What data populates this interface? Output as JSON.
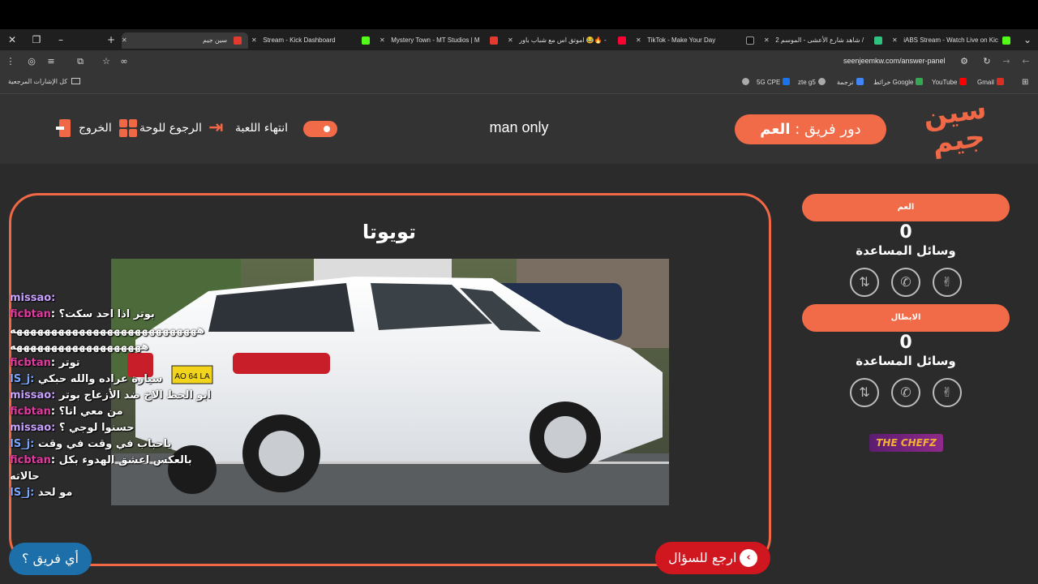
{
  "browser": {
    "tabs": [
      {
        "title": "سين جيم",
        "color": "#e23a2f"
      },
      {
        "title": "Stream - Kick Dashboard",
        "color": "#53fc18"
      },
      {
        "title": "Mystery Town - MT Studios | M",
        "color": "#e23a2f"
      },
      {
        "title": "اموتق اس مع شباب باور 😂🔥 -",
        "color": "#ff0033"
      },
      {
        "title": "TikTok - Make Your Day",
        "color": "#111111"
      },
      {
        "title": "شاهد شارع الأعشى - الموسم 2 /",
        "color": "#2ec27e"
      },
      {
        "title": "iABS Stream - Watch Live on Kic",
        "color": "#53fc18"
      }
    ],
    "url": "seenjeemkw.com/answer-panel",
    "bookmarks_folder": "كل الإشارات المرجعية",
    "bookmarks": [
      {
        "label": "Gmail",
        "color": "#d93025"
      },
      {
        "label": "YouTube",
        "color": "#ff0000"
      },
      {
        "label": "خرائط Google",
        "color": "#34a853"
      },
      {
        "label": "ترجمة",
        "color": "#4285f4"
      },
      {
        "label": "zte g5",
        "color": "#aaaaaa"
      },
      {
        "label": "5G CPE",
        "color": "#1a73e8"
      }
    ]
  },
  "header": {
    "logo_line1": "سين",
    "logo_line2": "جيم",
    "turn_prefix": "دور فريق :",
    "turn_team": "العم",
    "mode": "man only",
    "end_game": "انتهاء اللعبة",
    "back_to_board": "الرجوع للوحة",
    "exit": "الخروج"
  },
  "question": {
    "answer": "تويوتا",
    "plate_text": "AO 64 LA"
  },
  "teams": [
    {
      "name": "العم",
      "score": "0",
      "aids_title": "وسائل المساعدة"
    },
    {
      "name": "الابطال",
      "score": "0",
      "aids_title": "وسائل المساعدة"
    }
  ],
  "sponsor": {
    "a": "THE ",
    "b": "CHEFZ"
  },
  "buttons": {
    "back_to_question": "ارجع للسؤال",
    "which_team": "أي فريق ؟"
  },
  "chat": [
    {
      "user": "missao:",
      "text": "",
      "user_color": "pur"
    },
    {
      "user": "ficbtan",
      "text": ": بوتر اذا احد سكت؟",
      "user_color": "pink"
    },
    {
      "user": "",
      "text": "هههههههههههههههههههههههههههه",
      "user_color": "pink"
    },
    {
      "user": "",
      "text": "هههههههههههههههههههه",
      "user_color": "pink"
    },
    {
      "user": "ficbtan",
      "text": ": توتر",
      "user_color": "pink"
    },
    {
      "user": "IS_j:",
      "text": " سيارة عراده والله حبكي",
      "user_color": "blue"
    },
    {
      "user": "missao:",
      "text": " ابو الحظ الاخ ضد الأزعاج بوتر",
      "user_color": "pur"
    },
    {
      "user": "ficbtan",
      "text": ": من معي انا؟",
      "user_color": "pink"
    },
    {
      "user": "missao:",
      "text": " حسنوا لوجي ؟",
      "user_color": "pur"
    },
    {
      "user": "IS_j:",
      "text": " ياحباب في وقت في وقت",
      "user_color": "blue"
    },
    {
      "user": "ficbtan",
      "text": ": بالعكس اعشق الهدوء بكل",
      "user_color": "pink"
    },
    {
      "user": "",
      "text": "حالاته",
      "user_color": "pink"
    },
    {
      "user": "IS_j:",
      "text": " مو لحد",
      "user_color": "blue"
    }
  ]
}
